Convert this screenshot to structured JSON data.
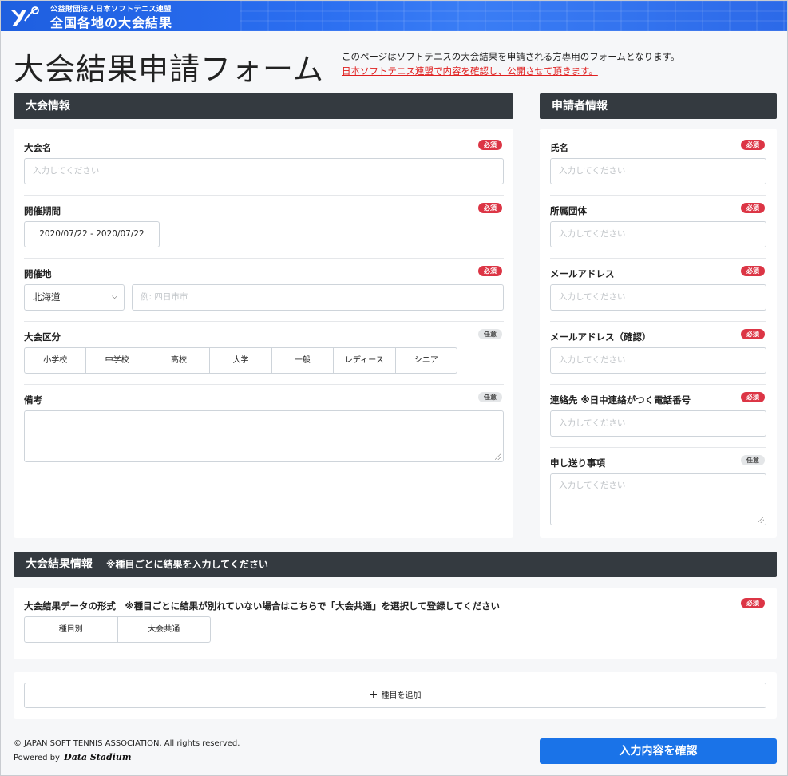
{
  "header": {
    "org_name": "公益財団法人日本ソフトテニス連盟",
    "site_title": "全国各地の大会結果"
  },
  "page": {
    "title": "大会結果申請フォーム",
    "intro_line1": "このページはソフトテニスの大会結果を申請される方専用のフォームとなります。",
    "intro_line2": "日本ソフトテニス連盟で内容を確認し、公開させて頂きます。"
  },
  "badges": {
    "required": "必須",
    "optional": "任意"
  },
  "tournament_info": {
    "header": "大会情報",
    "name": {
      "label": "大会名",
      "placeholder": "入力してください"
    },
    "period": {
      "label": "開催期間",
      "value": "2020/07/22 - 2020/07/22"
    },
    "venue": {
      "label": "開催地",
      "prefecture": "北海道",
      "city_placeholder": "例: 四日市市"
    },
    "category": {
      "label": "大会区分",
      "options": [
        "小学校",
        "中学校",
        "高校",
        "大学",
        "一般",
        "レディース",
        "シニア"
      ]
    },
    "notes": {
      "label": "備考"
    }
  },
  "applicant_info": {
    "header": "申請者情報",
    "name": {
      "label": "氏名",
      "placeholder": "入力してください"
    },
    "organization": {
      "label": "所属団体",
      "placeholder": "入力してください"
    },
    "email": {
      "label": "メールアドレス",
      "placeholder": "入力してください"
    },
    "email_confirm": {
      "label": "メールアドレス（確認）",
      "placeholder": "入力してください"
    },
    "contact": {
      "label": "連絡先 ※日中連絡がつく電話番号",
      "placeholder": "入力してください"
    },
    "message": {
      "label": "申し送り事項",
      "placeholder": "入力してください"
    }
  },
  "results_info": {
    "header": "大会結果情報",
    "header_note": "※種目ごとに結果を入力してください",
    "format_label": "大会結果データの形式　※種目ごとに結果が別れていない場合はこちらで「大会共通」を選択して登録してください",
    "format_options": [
      "種目別",
      "大会共通"
    ],
    "add_event": "種目を追加"
  },
  "footer": {
    "copyright": "© JAPAN SOFT TENNIS ASSOCIATION. All rights reserved.",
    "powered_by": "Powered by",
    "powered_logo": "Data Stadium"
  },
  "confirm_button": "入力内容を確認",
  "colors": {
    "header_blue": "#2b6ef0",
    "section_dark": "#343a40",
    "required_red": "#dc3545",
    "link_red": "#e02020",
    "primary_button": "#1a73e8"
  }
}
